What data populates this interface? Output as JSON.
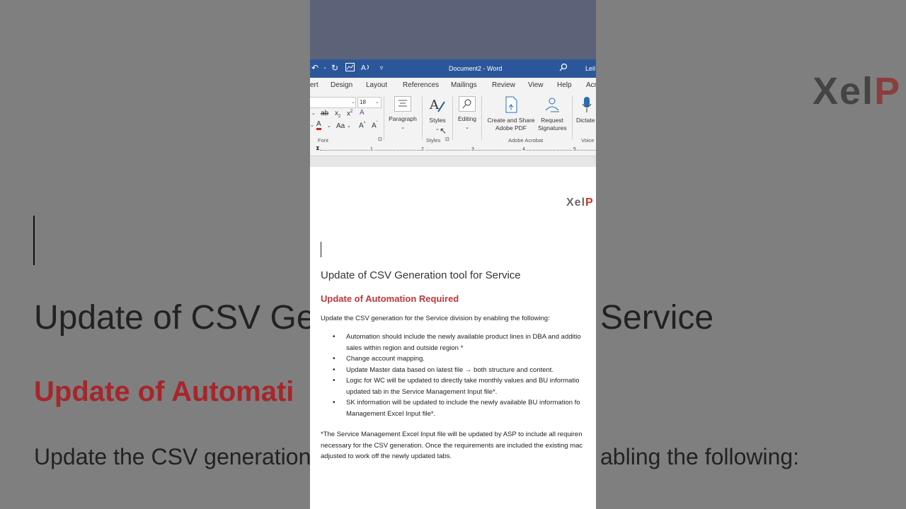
{
  "background": {
    "heading": "Update of CSV Ge",
    "heading_right": "Service",
    "subheading": "Update of Automati",
    "body": "Update the CSV generation",
    "body_right": "abling the following:",
    "logo_main": "Xel",
    "logo_accent": "P"
  },
  "titlebar": {
    "title": "Document2  -  Word",
    "user": "Leil"
  },
  "tabs": [
    "ert",
    "Design",
    "Layout",
    "References",
    "Mailings",
    "Review",
    "View",
    "Help",
    "Acr"
  ],
  "ribbon": {
    "font_size": "18",
    "groups": {
      "font": "Font",
      "styles": "Styles",
      "adobe": "Adobe Acrobat",
      "voice": "Voice"
    },
    "buttons": {
      "paragraph": "Paragraph",
      "styles": "Styles",
      "editing": "Editing",
      "create_share_1": "Create and Share",
      "create_share_2": "Adobe PDF",
      "request_1": "Request",
      "request_2": "Signatures",
      "dictate": "Dictate"
    }
  },
  "ruler": [
    "1",
    "2",
    "3",
    "4",
    "5"
  ],
  "document": {
    "logo_main": "Xel",
    "logo_accent": "P",
    "heading": "Update of CSV Generation tool for Service",
    "subheading": "Update of Automation Required",
    "intro": "Update the CSV generation for the Service division by enabling the following:",
    "bullets": [
      "Automation should include the newly available product lines in DBA and additio",
      "sales within region and outside region *",
      "Change account mapping.",
      "Update Master data based on latest file → both structure and content.",
      "Logic for WC will be updated to directly take monthly values and BU informatio",
      "updated tab in the Service Management Input file*.",
      "SK information will be updated to include the newly available BU information fo",
      "Management Excel Input file*."
    ],
    "note": [
      "*The Service Management Excel Input file will be updated by ASP to include all requiren",
      "necessary for the CSV generation. Once the requirements are included the existing mac",
      "adjusted to work off the newly updated tabs."
    ]
  }
}
